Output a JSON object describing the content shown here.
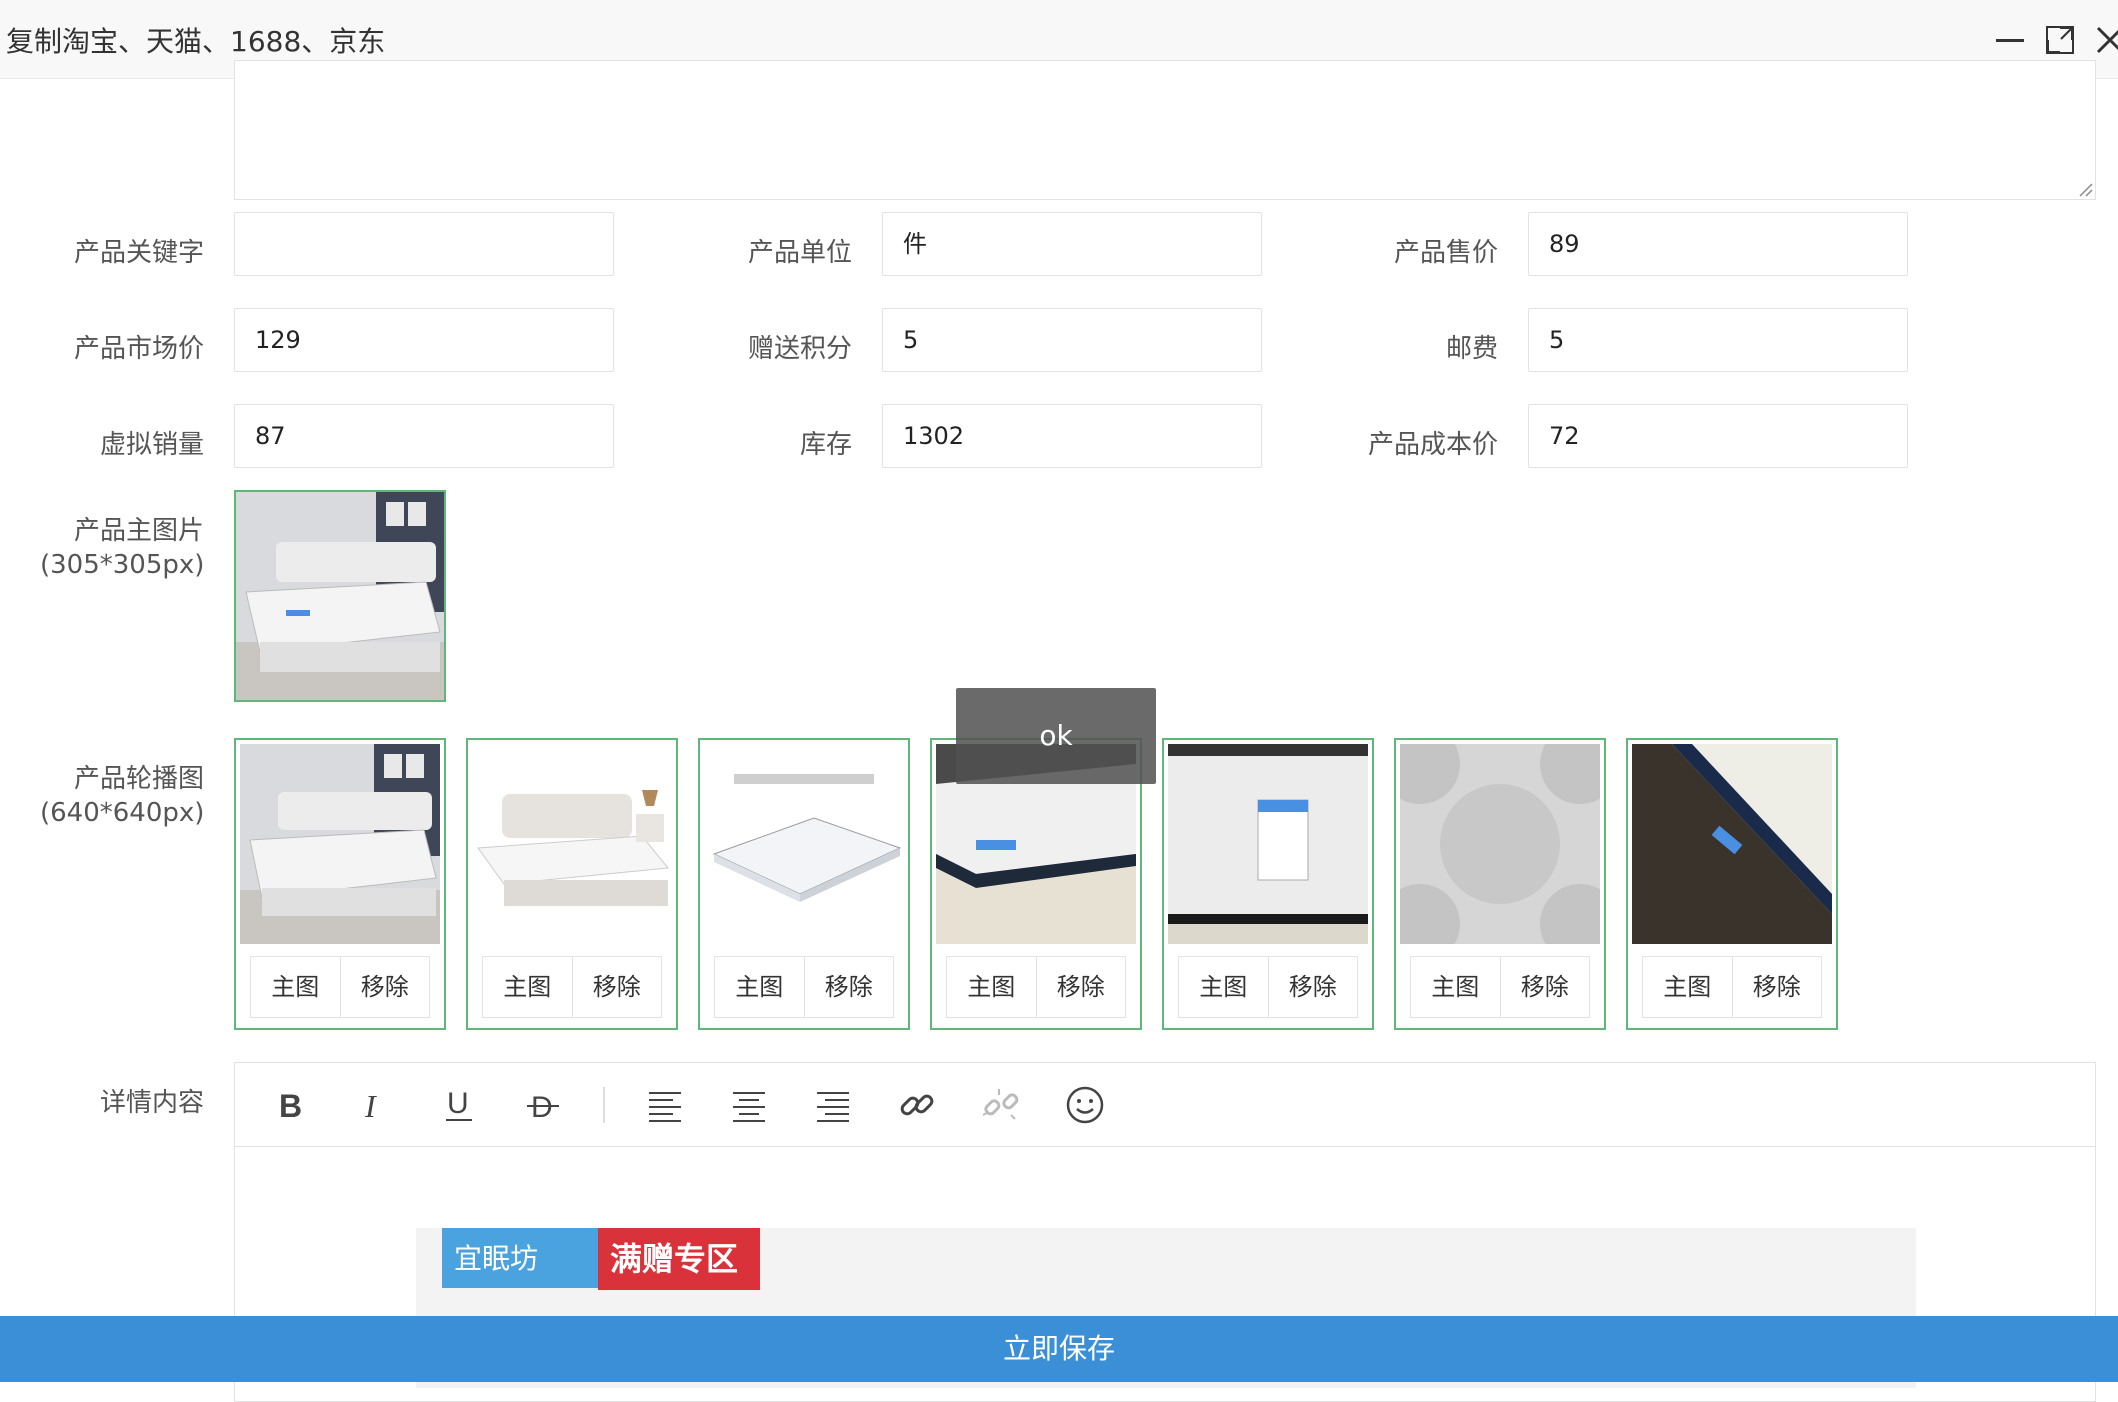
{
  "window": {
    "title": "复制淘宝、天猫、1688、京东"
  },
  "form": {
    "keyword_label": "产品关键字",
    "keyword_value": "",
    "unit_label": "产品单位",
    "unit_value": "件",
    "price_label": "产品售价",
    "price_value": "89",
    "market_price_label": "产品市场价",
    "market_price_value": "129",
    "points_label": "赠送积分",
    "points_value": "5",
    "postage_label": "邮费",
    "postage_value": "5",
    "virtual_sales_label": "虚拟销量",
    "virtual_sales_value": "87",
    "stock_label": "库存",
    "stock_value": "1302",
    "cost_label": "产品成本价",
    "cost_value": "72",
    "main_image_label": "产品主图片",
    "main_image_size": "(305*305px)",
    "carousel_label": "产品轮播图",
    "carousel_size": "(640*640px)",
    "detail_label": "详情内容"
  },
  "carousel": {
    "main_btn": "主图",
    "remove_btn": "移除"
  },
  "toast": {
    "text": "ok"
  },
  "banner": {
    "brand": "宜眠坊",
    "promo": "满赠专区"
  },
  "footer": {
    "save_label": "立即保存"
  },
  "colors": {
    "accent": "#3a8fd6",
    "selected_border": "#5fb878"
  }
}
